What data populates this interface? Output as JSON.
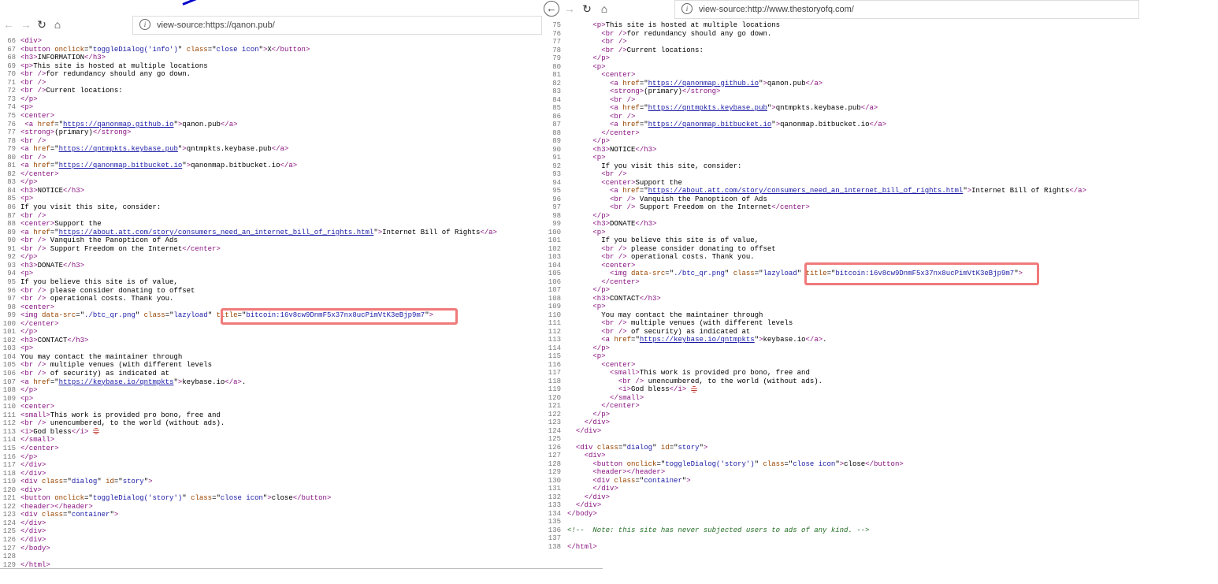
{
  "left": {
    "url": "view-source:https://qanon.pub/",
    "lines": [
      {
        "n": "66",
        "html": "<span class=\"tag\">&lt;div&gt;</span>"
      },
      {
        "n": "67",
        "html": "<span class=\"tag\">&lt;button</span> <span class=\"anm\">onclick</span>=\"<span class=\"av\">toggleDialog('info')</span>\" <span class=\"anm\">class</span>=\"<span class=\"av\">close icon</span>\"<span class=\"tag\">&gt;</span>X<span class=\"tag\">&lt;/button&gt;</span>"
      },
      {
        "n": "68",
        "html": "<span class=\"tag\">&lt;h3&gt;</span>INFORMATION<span class=\"tag\">&lt;/h3&gt;</span>"
      },
      {
        "n": "69",
        "html": "<span class=\"tag\">&lt;p&gt;</span>This site is hosted at multiple locations"
      },
      {
        "n": "70",
        "html": "<span class=\"tag\">&lt;br /&gt;</span>for redundancy should any go down."
      },
      {
        "n": "71",
        "html": "<span class=\"tag\">&lt;br /&gt;</span>"
      },
      {
        "n": "72",
        "html": "<span class=\"tag\">&lt;br /&gt;</span>Current locations:"
      },
      {
        "n": "73",
        "html": "<span class=\"tag\">&lt;/p&gt;</span>"
      },
      {
        "n": "74",
        "html": "<span class=\"tag\">&lt;p&gt;</span>"
      },
      {
        "n": "75",
        "html": "<span class=\"tag\">&lt;center&gt;</span>"
      },
      {
        "n": "76",
        "html": " <span class=\"tag\">&lt;a</span> <span class=\"anm\">href</span>=\"<span class=\"lnk\">https://qanonmap.github.io</span>\"<span class=\"tag\">&gt;</span>qanon.pub<span class=\"tag\">&lt;/a&gt;</span>"
      },
      {
        "n": "77",
        "html": "<span class=\"tag\">&lt;strong&gt;</span>(primary)<span class=\"tag\">&lt;/strong&gt;</span>"
      },
      {
        "n": "78",
        "html": "<span class=\"tag\">&lt;br /&gt;</span>"
      },
      {
        "n": "79",
        "html": "<span class=\"tag\">&lt;a</span> <span class=\"anm\">href</span>=\"<span class=\"lnk\">https://qntmpkts.keybase.pub</span>\"<span class=\"tag\">&gt;</span>qntmpkts.keybase.pub<span class=\"tag\">&lt;/a&gt;</span>"
      },
      {
        "n": "80",
        "html": "<span class=\"tag\">&lt;br /&gt;</span>"
      },
      {
        "n": "81",
        "html": "<span class=\"tag\">&lt;a</span> <span class=\"anm\">href</span>=\"<span class=\"lnk\">https://qanonmap.bitbucket.io</span>\"<span class=\"tag\">&gt;</span>qanonmap.bitbucket.io<span class=\"tag\">&lt;/a&gt;</span>"
      },
      {
        "n": "82",
        "html": "<span class=\"tag\">&lt;/center&gt;</span>"
      },
      {
        "n": "83",
        "html": "<span class=\"tag\">&lt;/p&gt;</span>"
      },
      {
        "n": "84",
        "html": "<span class=\"tag\">&lt;h3&gt;</span>NOTICE<span class=\"tag\">&lt;/h3&gt;</span>"
      },
      {
        "n": "85",
        "html": "<span class=\"tag\">&lt;p&gt;</span>"
      },
      {
        "n": "86",
        "html": "If you visit this site, consider:"
      },
      {
        "n": "87",
        "html": "<span class=\"tag\">&lt;br /&gt;</span>"
      },
      {
        "n": "88",
        "html": "<span class=\"tag\">&lt;center&gt;</span>Support the"
      },
      {
        "n": "89",
        "html": "<span class=\"tag\">&lt;a</span> <span class=\"anm\">href</span>=\"<span class=\"lnk\">https://about.att.com/story/consumers_need_an_internet_bill_of_rights.html</span>\"<span class=\"tag\">&gt;</span>Internet Bill of Rights<span class=\"tag\">&lt;/a&gt;</span>"
      },
      {
        "n": "90",
        "html": "<span class=\"tag\">&lt;br /&gt;</span> Vanquish the Panopticon of Ads"
      },
      {
        "n": "91",
        "html": "<span class=\"tag\">&lt;br /&gt;</span> Support Freedom on the Internet<span class=\"tag\">&lt;/center&gt;</span>"
      },
      {
        "n": "92",
        "html": "<span class=\"tag\">&lt;/p&gt;</span>"
      },
      {
        "n": "93",
        "html": "<span class=\"tag\">&lt;h3&gt;</span>DONATE<span class=\"tag\">&lt;/h3&gt;</span>"
      },
      {
        "n": "94",
        "html": "<span class=\"tag\">&lt;p&gt;</span>"
      },
      {
        "n": "95",
        "html": "If you believe this site is of value,"
      },
      {
        "n": "96",
        "html": "<span class=\"tag\">&lt;br /&gt;</span> please consider donating to offset"
      },
      {
        "n": "97",
        "html": "<span class=\"tag\">&lt;br /&gt;</span> operational costs. Thank you."
      },
      {
        "n": "98",
        "html": "<span class=\"tag\">&lt;center&gt;</span>"
      },
      {
        "n": "99",
        "html": "<span class=\"tag\">&lt;img</span> <span class=\"anm\">data-src</span>=\"<span class=\"av\">./btc_qr.png</span>\" <span class=\"anm\">class</span>=\"<span class=\"av\">lazyload</span>\" <span class=\"anm\">title</span>=\"<span class=\"av\">bitcoin:16v8cw9DnmF5x37nx8ucPimVtK3eBjp9m7</span>\"<span class=\"tag\">&gt;</span>"
      },
      {
        "n": "100",
        "html": "<span class=\"tag\">&lt;/center&gt;</span>"
      },
      {
        "n": "101",
        "html": "<span class=\"tag\">&lt;/p&gt;</span>"
      },
      {
        "n": "102",
        "html": "<span class=\"tag\">&lt;h3&gt;</span>CONTACT<span class=\"tag\">&lt;/h3&gt;</span>"
      },
      {
        "n": "103",
        "html": "<span class=\"tag\">&lt;p&gt;</span>"
      },
      {
        "n": "104",
        "html": "You may contact the maintainer through"
      },
      {
        "n": "105",
        "html": "<span class=\"tag\">&lt;br /&gt;</span> multiple venues (with different levels"
      },
      {
        "n": "106",
        "html": "<span class=\"tag\">&lt;br /&gt;</span> of security) as indicated at"
      },
      {
        "n": "107",
        "html": "<span class=\"tag\">&lt;a</span> <span class=\"anm\">href</span>=\"<span class=\"lnk\">https://keybase.io/qntmpkts</span>\"<span class=\"tag\">&gt;</span>keybase.io<span class=\"tag\">&lt;/a&gt;</span>."
      },
      {
        "n": "108",
        "html": "<span class=\"tag\">&lt;/p&gt;</span>"
      },
      {
        "n": "109",
        "html": "<span class=\"tag\">&lt;p&gt;</span>"
      },
      {
        "n": "110",
        "html": "<span class=\"tag\">&lt;center&gt;</span>"
      },
      {
        "n": "111",
        "html": "<span class=\"tag\">&lt;small&gt;</span>This work is provided pro bono, free and"
      },
      {
        "n": "112",
        "html": "<span class=\"tag\">&lt;br /&gt;</span> unencumbered, to the world (without ads)."
      },
      {
        "n": "113",
        "html": "<span class=\"tag\">&lt;i&gt;</span>God bless<span class=\"tag\">&lt;/i&gt;</span> <span class=\"flag\"></span>"
      },
      {
        "n": "114",
        "html": "<span class=\"tag\">&lt;/small&gt;</span>"
      },
      {
        "n": "115",
        "html": "<span class=\"tag\">&lt;/center&gt;</span>"
      },
      {
        "n": "116",
        "html": "<span class=\"tag\">&lt;/p&gt;</span>"
      },
      {
        "n": "117",
        "html": "<span class=\"tag\">&lt;/div&gt;</span>"
      },
      {
        "n": "118",
        "html": "<span class=\"tag\">&lt;/div&gt;</span>"
      },
      {
        "n": "119",
        "html": "<span class=\"tag\">&lt;div</span> <span class=\"anm\">class</span>=\"<span class=\"av\">dialog</span>\" <span class=\"anm\">id</span>=\"<span class=\"av\">story</span>\"<span class=\"tag\">&gt;</span>"
      },
      {
        "n": "120",
        "html": "<span class=\"tag\">&lt;div&gt;</span>"
      },
      {
        "n": "121",
        "html": "<span class=\"tag\">&lt;button</span> <span class=\"anm\">onclick</span>=\"<span class=\"av\">toggleDialog('story')</span>\" <span class=\"anm\">class</span>=\"<span class=\"av\">close icon</span>\"<span class=\"tag\">&gt;</span>close<span class=\"tag\">&lt;/button&gt;</span>"
      },
      {
        "n": "122",
        "html": "<span class=\"tag\">&lt;header&gt;&lt;/header&gt;</span>"
      },
      {
        "n": "123",
        "html": "<span class=\"tag\">&lt;div</span> <span class=\"anm\">class</span>=\"<span class=\"av\">container</span>\"<span class=\"tag\">&gt;</span>"
      },
      {
        "n": "124",
        "html": "<span class=\"tag\">&lt;/div&gt;</span>"
      },
      {
        "n": "125",
        "html": "<span class=\"tag\">&lt;/div&gt;</span>"
      },
      {
        "n": "126",
        "html": "<span class=\"tag\">&lt;/div&gt;</span>"
      },
      {
        "n": "127",
        "html": "<span class=\"tag\">&lt;/body&gt;</span>"
      },
      {
        "n": "128",
        "html": ""
      },
      {
        "n": "129",
        "html": "<span class=\"tag\">&lt;/html&gt;</span>"
      }
    ]
  },
  "right": {
    "url": "view-source:http://www.thestoryofq.com/",
    "lines": [
      {
        "n": "75",
        "html": "      <span class=\"tag\">&lt;p&gt;</span>This site is hosted at multiple locations"
      },
      {
        "n": "76",
        "html": "        <span class=\"tag\">&lt;br /&gt;</span>for redundancy should any go down."
      },
      {
        "n": "77",
        "html": "        <span class=\"tag\">&lt;br /&gt;</span>"
      },
      {
        "n": "78",
        "html": "        <span class=\"tag\">&lt;br /&gt;</span>Current locations:"
      },
      {
        "n": "79",
        "html": "      <span class=\"tag\">&lt;/p&gt;</span>"
      },
      {
        "n": "80",
        "html": "      <span class=\"tag\">&lt;p&gt;</span>"
      },
      {
        "n": "81",
        "html": "        <span class=\"tag\">&lt;center&gt;</span>"
      },
      {
        "n": "82",
        "html": "          <span class=\"tag\">&lt;a</span> <span class=\"anm\">href</span>=\"<span class=\"lnk\">https://qanonmap.github.io</span>\"<span class=\"tag\">&gt;</span>qanon.pub<span class=\"tag\">&lt;/a&gt;</span>"
      },
      {
        "n": "83",
        "html": "          <span class=\"tag\">&lt;strong&gt;</span>(primary)<span class=\"tag\">&lt;/strong&gt;</span>"
      },
      {
        "n": "84",
        "html": "          <span class=\"tag\">&lt;br /&gt;</span>"
      },
      {
        "n": "85",
        "html": "          <span class=\"tag\">&lt;a</span> <span class=\"anm\">href</span>=\"<span class=\"lnk\">https://qntmpkts.keybase.pub</span>\"<span class=\"tag\">&gt;</span>qntmpkts.keybase.pub<span class=\"tag\">&lt;/a&gt;</span>"
      },
      {
        "n": "86",
        "html": "          <span class=\"tag\">&lt;br /&gt;</span>"
      },
      {
        "n": "87",
        "html": "          <span class=\"tag\">&lt;a</span> <span class=\"anm\">href</span>=\"<span class=\"lnk\">https://qanonmap.bitbucket.io</span>\"<span class=\"tag\">&gt;</span>qanonmap.bitbucket.io<span class=\"tag\">&lt;/a&gt;</span>"
      },
      {
        "n": "88",
        "html": "        <span class=\"tag\">&lt;/center&gt;</span>"
      },
      {
        "n": "89",
        "html": "      <span class=\"tag\">&lt;/p&gt;</span>"
      },
      {
        "n": "90",
        "html": "      <span class=\"tag\">&lt;h3&gt;</span>NOTICE<span class=\"tag\">&lt;/h3&gt;</span>"
      },
      {
        "n": "91",
        "html": "      <span class=\"tag\">&lt;p&gt;</span>"
      },
      {
        "n": "92",
        "html": "        If you visit this site, consider:"
      },
      {
        "n": "93",
        "html": "        <span class=\"tag\">&lt;br /&gt;</span>"
      },
      {
        "n": "94",
        "html": "        <span class=\"tag\">&lt;center&gt;</span>Support the"
      },
      {
        "n": "95",
        "html": "          <span class=\"tag\">&lt;a</span> <span class=\"anm\">href</span>=\"<span class=\"lnk\">https://about.att.com/story/consumers_need_an_internet_bill_of_rights.html</span>\"<span class=\"tag\">&gt;</span>Internet Bill of Rights<span class=\"tag\">&lt;/a&gt;</span>"
      },
      {
        "n": "96",
        "html": "          <span class=\"tag\">&lt;br /&gt;</span> Vanquish the Panopticon of Ads"
      },
      {
        "n": "97",
        "html": "          <span class=\"tag\">&lt;br /&gt;</span> Support Freedom on the Internet<span class=\"tag\">&lt;/center&gt;</span>"
      },
      {
        "n": "98",
        "html": "      <span class=\"tag\">&lt;/p&gt;</span>"
      },
      {
        "n": "99",
        "html": "      <span class=\"tag\">&lt;h3&gt;</span>DONATE<span class=\"tag\">&lt;/h3&gt;</span>"
      },
      {
        "n": "100",
        "html": "      <span class=\"tag\">&lt;p&gt;</span>"
      },
      {
        "n": "101",
        "html": "        If you believe this site is of value,"
      },
      {
        "n": "102",
        "html": "        <span class=\"tag\">&lt;br /&gt;</span> please consider donating to offset"
      },
      {
        "n": "103",
        "html": "        <span class=\"tag\">&lt;br /&gt;</span> operational costs. Thank you."
      },
      {
        "n": "104",
        "html": "        <span class=\"tag\">&lt;center&gt;</span>"
      },
      {
        "n": "105",
        "html": "          <span class=\"tag\">&lt;img</span> <span class=\"anm\">data-src</span>=\"<span class=\"av\">./btc_qr.png</span>\" <span class=\"anm\">class</span>=\"<span class=\"av\">lazyload</span>\" <span class=\"anm\">title</span>=\"<span class=\"av\">bitcoin:16v8cw9DnmF5x37nx8ucPimVtK3eBjp9m7</span>\"<span class=\"tag\">&gt;</span>"
      },
      {
        "n": "106",
        "html": "        <span class=\"tag\">&lt;/center&gt;</span>"
      },
      {
        "n": "107",
        "html": "      <span class=\"tag\">&lt;/p&gt;</span>"
      },
      {
        "n": "108",
        "html": "      <span class=\"tag\">&lt;h3&gt;</span>CONTACT<span class=\"tag\">&lt;/h3&gt;</span>"
      },
      {
        "n": "109",
        "html": "      <span class=\"tag\">&lt;p&gt;</span>"
      },
      {
        "n": "110",
        "html": "        You may contact the maintainer through"
      },
      {
        "n": "111",
        "html": "        <span class=\"tag\">&lt;br /&gt;</span> multiple venues (with different levels"
      },
      {
        "n": "112",
        "html": "        <span class=\"tag\">&lt;br /&gt;</span> of security) as indicated at"
      },
      {
        "n": "113",
        "html": "        <span class=\"tag\">&lt;a</span> <span class=\"anm\">href</span>=\"<span class=\"lnk\">https://keybase.io/qntmpkts</span>\"<span class=\"tag\">&gt;</span>keybase.io<span class=\"tag\">&lt;/a&gt;</span>."
      },
      {
        "n": "114",
        "html": "      <span class=\"tag\">&lt;/p&gt;</span>"
      },
      {
        "n": "115",
        "html": "      <span class=\"tag\">&lt;p&gt;</span>"
      },
      {
        "n": "116",
        "html": "        <span class=\"tag\">&lt;center&gt;</span>"
      },
      {
        "n": "117",
        "html": "          <span class=\"tag\">&lt;small&gt;</span>This work is provided pro bono, free and"
      },
      {
        "n": "118",
        "html": "            <span class=\"tag\">&lt;br /&gt;</span> unencumbered, to the world (without ads)."
      },
      {
        "n": "119",
        "html": "            <span class=\"tag\">&lt;i&gt;</span>God bless<span class=\"tag\">&lt;/i&gt;</span> <span class=\"flag\"></span>"
      },
      {
        "n": "120",
        "html": "          <span class=\"tag\">&lt;/small&gt;</span>"
      },
      {
        "n": "121",
        "html": "        <span class=\"tag\">&lt;/center&gt;</span>"
      },
      {
        "n": "122",
        "html": "      <span class=\"tag\">&lt;/p&gt;</span>"
      },
      {
        "n": "123",
        "html": "    <span class=\"tag\">&lt;/div&gt;</span>"
      },
      {
        "n": "124",
        "html": "  <span class=\"tag\">&lt;/div&gt;</span>"
      },
      {
        "n": "125",
        "html": ""
      },
      {
        "n": "126",
        "html": "  <span class=\"tag\">&lt;div</span> <span class=\"anm\">class</span>=\"<span class=\"av\">dialog</span>\" <span class=\"anm\">id</span>=\"<span class=\"av\">story</span>\"<span class=\"tag\">&gt;</span>"
      },
      {
        "n": "127",
        "html": "    <span class=\"tag\">&lt;div&gt;</span>"
      },
      {
        "n": "128",
        "html": "      <span class=\"tag\">&lt;button</span> <span class=\"anm\">onclick</span>=\"<span class=\"av\">toggleDialog('story')</span>\" <span class=\"anm\">class</span>=\"<span class=\"av\">close icon</span>\"<span class=\"tag\">&gt;</span>close<span class=\"tag\">&lt;/button&gt;</span>"
      },
      {
        "n": "129",
        "html": "      <span class=\"tag\">&lt;header&gt;&lt;/header&gt;</span>"
      },
      {
        "n": "130",
        "html": "      <span class=\"tag\">&lt;div</span> <span class=\"anm\">class</span>=\"<span class=\"av\">container</span>\"<span class=\"tag\">&gt;</span>"
      },
      {
        "n": "131",
        "html": "      <span class=\"tag\">&lt;/div&gt;</span>"
      },
      {
        "n": "132",
        "html": "    <span class=\"tag\">&lt;/div&gt;</span>"
      },
      {
        "n": "133",
        "html": "  <span class=\"tag\">&lt;/div&gt;</span>"
      },
      {
        "n": "134",
        "html": "<span class=\"tag\">&lt;/body&gt;</span>"
      },
      {
        "n": "135",
        "html": ""
      },
      {
        "n": "136",
        "html": "<span class=\"cm\">&lt;!--  Note: this site has never subjected users to ads of any kind. --&gt;</span>"
      },
      {
        "n": "137",
        "html": ""
      },
      {
        "n": "138",
        "html": "<span class=\"tag\">&lt;/html&gt;</span>"
      }
    ]
  },
  "nav": {
    "back": "←",
    "forward": "→",
    "reload": "↻",
    "home": "⌂",
    "info": "i"
  },
  "colors": {
    "highlight": "#f07a7a",
    "tag": "#881280",
    "attr_name": "#994500",
    "attr_value": "#1a1aa6",
    "comment": "#236e25"
  }
}
